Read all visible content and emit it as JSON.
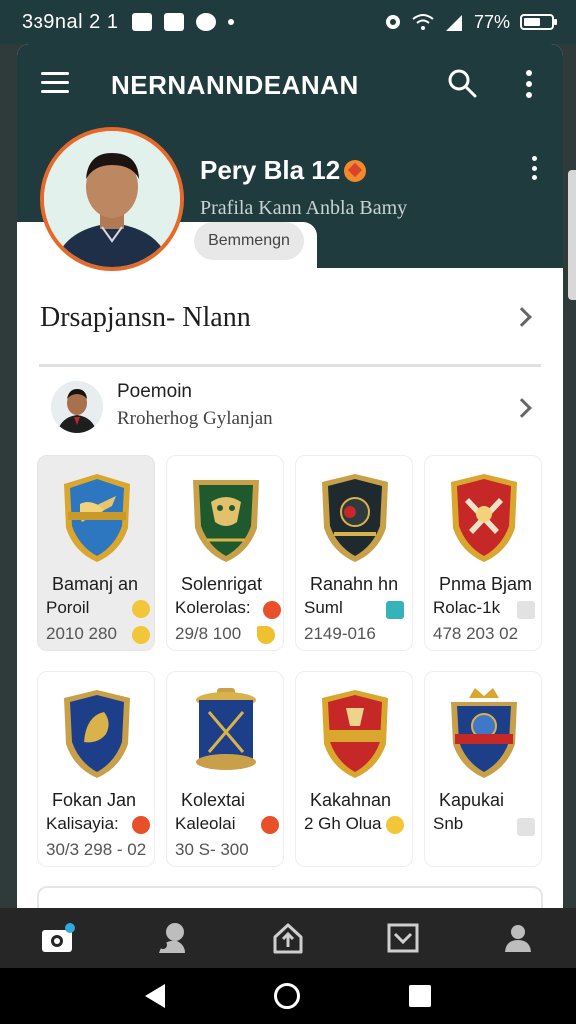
{
  "status": {
    "time": "3ɜ9nal 2 1",
    "battery": "77%"
  },
  "topbar": {
    "title": "NERNANNDEANAN"
  },
  "profile": {
    "name": "Pery Bla 12",
    "subtitle": "Prafila Kann Anbla Bamy",
    "chip": "Bemmengn"
  },
  "section": {
    "title": "Drsapjansn- Nlann"
  },
  "person_row": {
    "title": "Poemoin",
    "subtitle": "Rroherhog Gylanjan"
  },
  "tiles": [
    {
      "line1": "Bamanj an",
      "line2": "Poroil",
      "line3": "2010 280",
      "color": "#1f6fb8",
      "accent": "#d9a62e"
    },
    {
      "line1": "Solenrigat",
      "line2": "Kolerolas:",
      "line3": "29/8 100",
      "color": "#1f5a2e",
      "accent": "#d9a62e"
    },
    {
      "line1": "Ranahn hn",
      "line2": "Suml",
      "line3": "2149-016",
      "color": "#1f2a2e",
      "accent": "#d9a62e"
    },
    {
      "line1": "Pnma Bjam",
      "line2": "Rolac-1k",
      "line3": "478 203 02",
      "color": "#c62828",
      "accent": "#d9a62e"
    },
    {
      "line1": "Fokan Jan",
      "line2": "Kalisayia:",
      "line3": "30/3 298 - 02",
      "color": "#1d3f8a",
      "accent": "#d9a62e"
    },
    {
      "line1": "Kolextai",
      "line2": "Kaleolai",
      "line3": "30 S- 300",
      "color": "#1d3f8a",
      "accent": "#c9a04a"
    },
    {
      "line1": "Kakahnan",
      "line2": "2 Gh Olua",
      "line3": "",
      "color": "#c62828",
      "accent": "#d9a62e"
    },
    {
      "line1": "Kapukai",
      "line2": "Snb",
      "line3": "",
      "color": "#1d3f8a",
      "accent": "#c9a04a"
    }
  ],
  "colors": {
    "header": "#203b3d",
    "avatar_ring": "#e56a2a"
  },
  "nav": [
    "camera-icon",
    "profile-alt-icon",
    "home-icon",
    "inbox-icon",
    "person-icon"
  ]
}
